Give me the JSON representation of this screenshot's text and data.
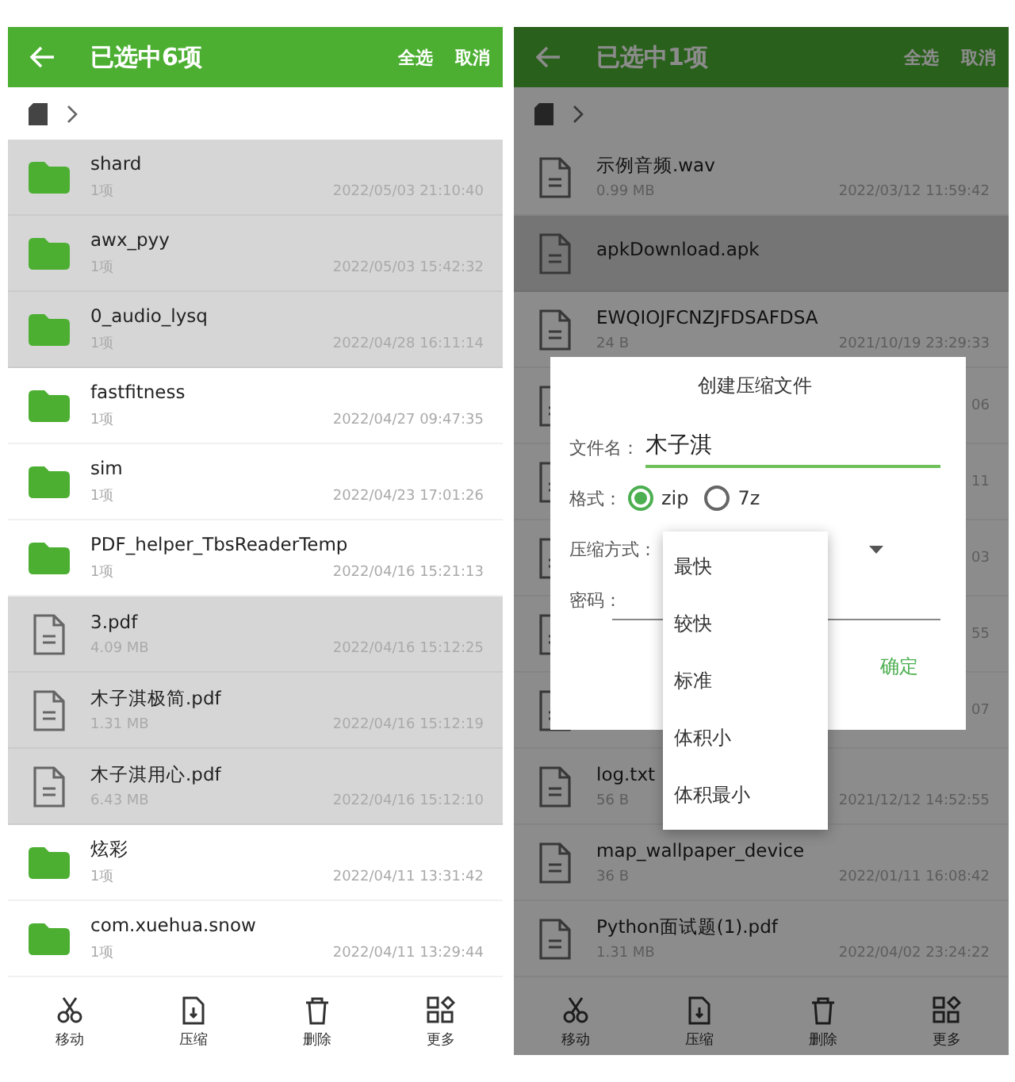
{
  "screens": [
    {
      "title": "已选中6项",
      "select_all": "全选",
      "cancel": "取消",
      "dimmed": false,
      "files": [
        {
          "kind": "folder",
          "name": "shard",
          "meta": "1项",
          "time": "2022/05/03 21:10:40",
          "selected": true
        },
        {
          "kind": "folder",
          "name": "awx_pyy",
          "meta": "1项",
          "time": "2022/05/03 15:42:32",
          "selected": true
        },
        {
          "kind": "folder",
          "name": "0_audio_lysq",
          "meta": "1项",
          "time": "2022/04/28 16:11:14",
          "selected": true
        },
        {
          "kind": "folder",
          "name": "fastfitness",
          "meta": "1项",
          "time": "2022/04/27 09:47:35",
          "selected": false
        },
        {
          "kind": "folder",
          "name": "sim",
          "meta": "1项",
          "time": "2022/04/23 17:01:26",
          "selected": false
        },
        {
          "kind": "folder",
          "name": "PDF_helper_TbsReaderTemp",
          "meta": "1项",
          "time": "2022/04/16 15:21:13",
          "selected": false
        },
        {
          "kind": "file",
          "name": "3.pdf",
          "meta": "4.09 MB",
          "time": "2022/04/16 15:12:25",
          "selected": true
        },
        {
          "kind": "file",
          "name": "木子淇极简.pdf",
          "meta": "1.31 MB",
          "time": "2022/04/16 15:12:19",
          "selected": true
        },
        {
          "kind": "file",
          "name": "木子淇用心.pdf",
          "meta": "6.43 MB",
          "time": "2022/04/16 15:12:10",
          "selected": true
        },
        {
          "kind": "folder",
          "name": "炫彩",
          "meta": "1项",
          "time": "2022/04/11 13:31:42",
          "selected": false
        },
        {
          "kind": "folder",
          "name": "com.xuehua.snow",
          "meta": "1项",
          "time": "2022/04/11 13:29:44",
          "selected": false
        }
      ],
      "actions": [
        {
          "kind": "cut",
          "label": "移动"
        },
        {
          "kind": "compress",
          "label": "压缩"
        },
        {
          "kind": "delete",
          "label": "删除"
        },
        {
          "kind": "more",
          "label": "更多"
        }
      ]
    },
    {
      "title": "已选中1项",
      "select_all": "全选",
      "cancel": "取消",
      "dimmed": true,
      "files": [
        {
          "kind": "file",
          "name": "示例音频.wav",
          "meta": "0.99 MB",
          "time": "2022/03/12 11:59:42",
          "selected": false
        },
        {
          "kind": "file",
          "name": "apkDownload.apk",
          "selected": true
        },
        {
          "kind": "file",
          "name": "EWQIOJFCNZJFDSAFDSA",
          "meta": "24 B",
          "time": "2021/10/19 23:29:33",
          "selected": false
        },
        {
          "kind": "covered",
          "time": "06",
          "selected": false
        },
        {
          "kind": "covered",
          "time": "11",
          "selected": false
        },
        {
          "kind": "covered",
          "time": "03",
          "selected": false
        },
        {
          "kind": "covered",
          "time": "55",
          "selected": false
        },
        {
          "kind": "covered",
          "time": "07",
          "selected": false
        },
        {
          "kind": "file",
          "name": "log.txt",
          "meta": "56 B",
          "time": "2021/12/12 14:52:55",
          "selected": false
        },
        {
          "kind": "file",
          "name": "map_wallpaper_device",
          "meta": "36 B",
          "time": "2022/01/11 16:08:42",
          "selected": false
        },
        {
          "kind": "file",
          "name": "Python面试题(1).pdf",
          "meta": "1.31 MB",
          "time": "2022/04/02 23:24:22",
          "selected": false
        }
      ],
      "actions": [
        {
          "kind": "cut",
          "label": "移动"
        },
        {
          "kind": "compress",
          "label": "压缩"
        },
        {
          "kind": "delete",
          "label": "删除"
        },
        {
          "kind": "more",
          "label": "更多"
        }
      ]
    }
  ],
  "dialog": {
    "title": "创建压缩文件",
    "filename_label": "文件名：",
    "filename": "木子淇",
    "format_label": "格式：",
    "formats": [
      {
        "label": "zip",
        "selected": true
      },
      {
        "label": "7z",
        "selected": false
      }
    ],
    "method_label": "压缩方式：",
    "password_label": "密码：",
    "confirm": "确定",
    "method_options": [
      "最快",
      "较快",
      "标准",
      "体积小",
      "体积最小"
    ]
  }
}
